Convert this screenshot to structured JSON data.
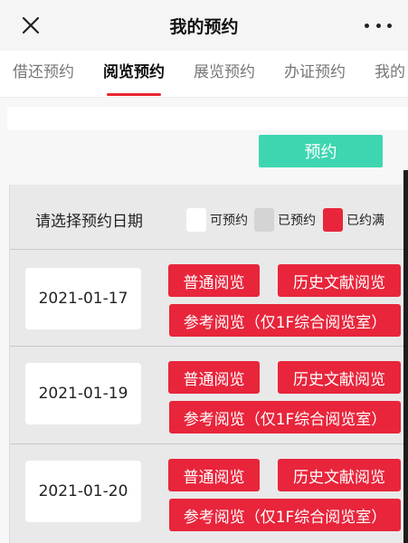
{
  "header": {
    "title": "我的预约"
  },
  "tabs": [
    {
      "label": "借还预约",
      "active": false
    },
    {
      "label": "阅览预约",
      "active": true
    },
    {
      "label": "展览预约",
      "active": false
    },
    {
      "label": "办证预约",
      "active": false
    },
    {
      "label": "我的",
      "active": false
    }
  ],
  "reserve_button": {
    "label": "预约",
    "color": "#3ed6b0"
  },
  "date_picker": {
    "label": "请选择预约日期",
    "legend": [
      {
        "label": "可预约",
        "color": "#ffffff"
      },
      {
        "label": "已预约",
        "color": "#d4d4d4"
      },
      {
        "label": "已约满",
        "color": "#e8253b"
      }
    ]
  },
  "dates": [
    {
      "date": "2021-01-17",
      "options": [
        "普通阅览",
        "历史文献阅览",
        "参考阅览（仅1F综合阅览室）"
      ]
    },
    {
      "date": "2021-01-19",
      "options": [
        "普通阅览",
        "历史文献阅览",
        "参考阅览（仅1F综合阅览室）"
      ]
    },
    {
      "date": "2021-01-20",
      "options": [
        "普通阅览",
        "历史文献阅览",
        "参考阅览（仅1F综合阅览室）"
      ]
    }
  ],
  "colors": {
    "accent": "#e8262f",
    "full": "#e8253b",
    "available": "#3ed6b0"
  }
}
